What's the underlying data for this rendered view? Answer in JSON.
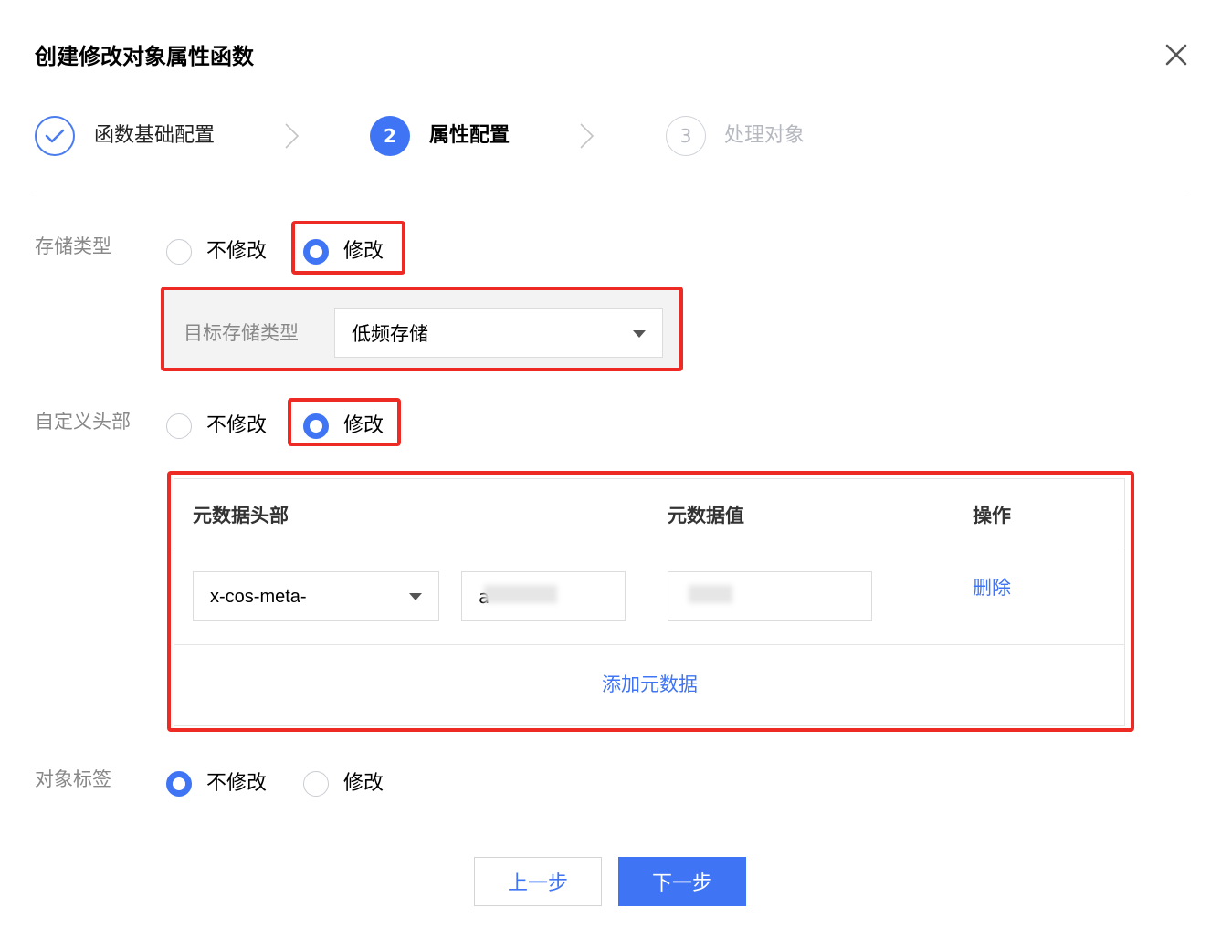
{
  "dialog": {
    "title": "创建修改对象属性函数"
  },
  "steps": [
    {
      "number": "",
      "label": "函数基础配置",
      "state": "done"
    },
    {
      "number": "2",
      "label": "属性配置",
      "state": "active"
    },
    {
      "number": "3",
      "label": "处理对象",
      "state": "pending"
    }
  ],
  "storage_type": {
    "label": "存储类型",
    "options": [
      "不修改",
      "修改"
    ],
    "selected": "修改",
    "target_label": "目标存储类型",
    "target_value": "低频存储"
  },
  "custom_header": {
    "label": "自定义头部",
    "options": [
      "不修改",
      "修改"
    ],
    "selected": "修改",
    "table": {
      "col_header": "元数据头部",
      "col_value": "元数据值",
      "col_action": "操作",
      "rows": [
        {
          "prefix": "x-cos-meta-",
          "key": "a",
          "value": "",
          "action": "删除"
        }
      ],
      "add_label": "添加元数据"
    }
  },
  "object_tags": {
    "label": "对象标签",
    "options": [
      "不修改",
      "修改"
    ],
    "selected": "不修改"
  },
  "footer": {
    "prev_label": "上一步",
    "next_label": "下一步"
  },
  "colors": {
    "accent": "#3f74f4",
    "highlight": "#ee2a24"
  }
}
